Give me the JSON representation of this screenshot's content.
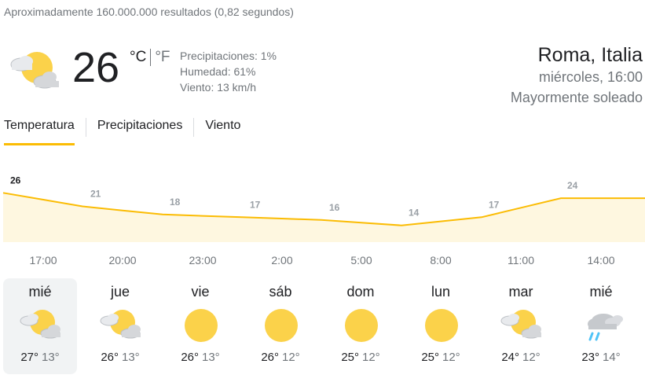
{
  "results_count": "Aproximadamente 160.000.000 resultados (0,82 segundos)",
  "current": {
    "temp": "26",
    "unit_c": "°C",
    "unit_f": "°F",
    "icon": "partly-sunny-icon",
    "precipitation": "Precipitaciones: 1%",
    "humidity": "Humedad: 61%",
    "wind": "Viento: 13 km/h"
  },
  "location": {
    "city": "Roma, Italia",
    "datetime": "miércoles, 16:00",
    "condition": "Mayormente soleado"
  },
  "tabs": [
    "Temperatura",
    "Precipitaciones",
    "Viento"
  ],
  "chart_data": {
    "type": "area",
    "x": [
      "17:00",
      "20:00",
      "23:00",
      "2:00",
      "5:00",
      "8:00",
      "11:00",
      "14:00"
    ],
    "series": [
      {
        "values": [
          26,
          21,
          18,
          17,
          16,
          14,
          17,
          24
        ]
      }
    ],
    "data_labels": [
      "26",
      "21",
      "18",
      "17",
      "16",
      "14",
      "17",
      "24"
    ],
    "colors": {
      "line": "#fbbc04",
      "fill": "#fef7e0",
      "active_label": "#202124",
      "label": "#9aa0a6"
    }
  },
  "forecast": [
    {
      "day": "mié",
      "hi": "27°",
      "lo": "13°",
      "icon": "partly-sunny-icon"
    },
    {
      "day": "jue",
      "hi": "26°",
      "lo": "13°",
      "icon": "partly-sunny-icon"
    },
    {
      "day": "vie",
      "hi": "26°",
      "lo": "13°",
      "icon": "sun-icon"
    },
    {
      "day": "sáb",
      "hi": "26°",
      "lo": "12°",
      "icon": "sun-icon"
    },
    {
      "day": "dom",
      "hi": "25°",
      "lo": "12°",
      "icon": "sun-icon"
    },
    {
      "day": "lun",
      "hi": "25°",
      "lo": "12°",
      "icon": "sun-icon"
    },
    {
      "day": "mar",
      "hi": "24°",
      "lo": "12°",
      "icon": "partly-sunny-icon"
    },
    {
      "day": "mié",
      "hi": "23°",
      "lo": "14°",
      "icon": "rain-icon"
    }
  ]
}
